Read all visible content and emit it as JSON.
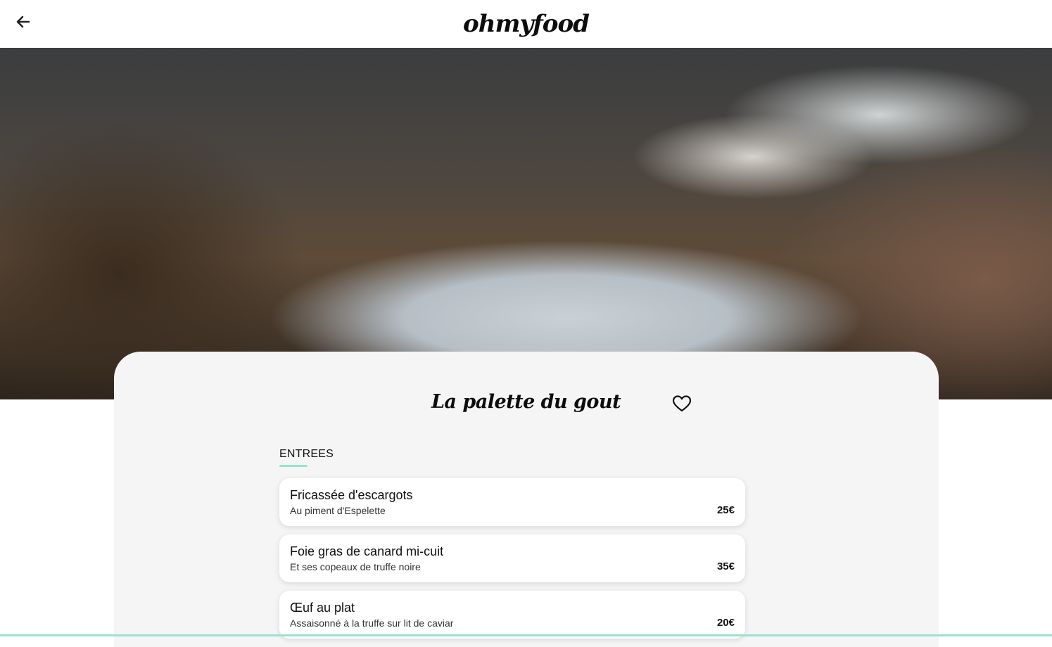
{
  "header": {
    "back_icon": "arrow-left-icon",
    "logo": "ohmyfood"
  },
  "restaurant": {
    "name": "La palette du gout",
    "favorite_icon": "heart-outline-icon"
  },
  "menu": {
    "section_label": "ENTREES",
    "items": [
      {
        "name": "Fricassée d'escargots",
        "description": "Au piment d'Espelette",
        "price": "25€"
      },
      {
        "name": "Foie gras de canard mi-cuit",
        "description": "Et ses copeaux de truffe noire",
        "price": "35€"
      },
      {
        "name": "Œuf au plat",
        "description": "Assaisonné à la truffe sur lit de caviar",
        "price": "20€"
      }
    ]
  },
  "colors": {
    "accent": "#99e2d0",
    "card_background": "#f5f5f5"
  }
}
